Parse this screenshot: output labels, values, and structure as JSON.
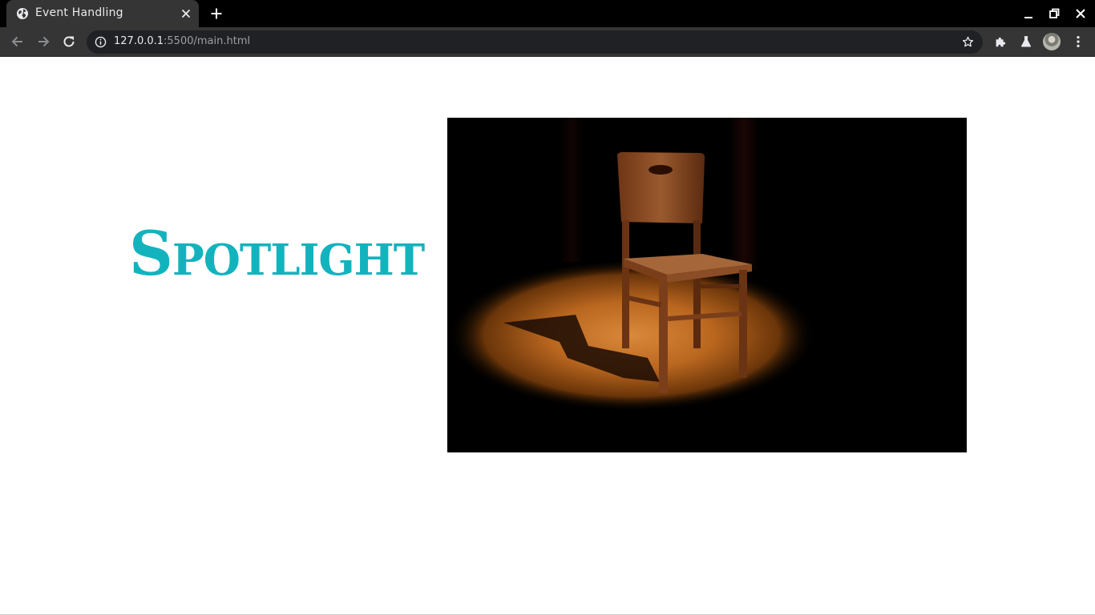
{
  "browser": {
    "tab_title": "Event Handling",
    "url_host": "127.0.0.1",
    "url_port_path": ":5500/main.html",
    "icons": {
      "favicon": "globe-icon",
      "close_tab": "close-icon",
      "new_tab": "plus-icon",
      "back": "arrow-left-icon",
      "forward": "arrow-right-icon",
      "reload": "reload-icon",
      "site_info": "info-icon",
      "bookmark": "star-icon",
      "extensions": "puzzle-icon",
      "labs": "flask-icon",
      "menu": "kebab-menu-icon"
    }
  },
  "page": {
    "heading": "Spotlight",
    "heading_color": "#13b3be",
    "image_subject": "wooden-chair-spotlight-photo"
  }
}
